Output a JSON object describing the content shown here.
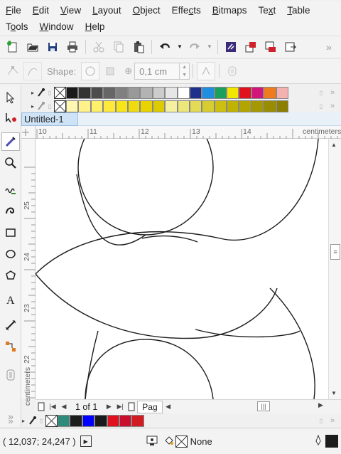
{
  "menus": {
    "row1": [
      {
        "label": "File",
        "u": "F",
        "rest": "ile"
      },
      {
        "label": "Edit",
        "u": "E",
        "rest": "dit"
      },
      {
        "label": "View",
        "u": "V",
        "rest": "iew"
      },
      {
        "label": "Layout",
        "u": "L",
        "rest": "ayout"
      },
      {
        "label": "Object",
        "u": "O",
        "rest": "bject"
      },
      {
        "label": "Effects",
        "pre": "Effe",
        "u": "c",
        "rest": "ts"
      },
      {
        "label": "Bitmaps",
        "u": "B",
        "rest": "itmaps"
      },
      {
        "label": "Text",
        "pre": "Te",
        "u": "x",
        "rest": "t"
      },
      {
        "label": "Table",
        "u": "T",
        "rest": "able"
      }
    ],
    "row2": [
      {
        "label": "Tools",
        "pre": "T",
        "u": "o",
        "rest": "ols"
      },
      {
        "label": "Window",
        "u": "W",
        "rest": "indow"
      },
      {
        "label": "Help",
        "u": "H",
        "rest": "elp"
      }
    ]
  },
  "property_bar": {
    "shape_label": "Shape:",
    "outline_width": "0,1 cm"
  },
  "palette_top": [
    "#1a1a1a",
    "#333333",
    "#4d4d4d",
    "#666666",
    "#808080",
    "#999999",
    "#b3b3b3",
    "#cccccc",
    "#e6e6e6",
    "#ffffff",
    "#1e2f8c",
    "#1e8fe0",
    "#1aa05a",
    "#f2e600",
    "#e0101e",
    "#d0167a",
    "#f07a1e",
    "#f5b0b0"
  ],
  "palette_second": [
    "#fff7b0",
    "#fff28a",
    "#fff06a",
    "#ffea3c",
    "#f7e51a",
    "#efdc10",
    "#e8d200",
    "#dccb00",
    "#f5f0a0",
    "#ede67a",
    "#e3da55",
    "#d8cd30",
    "#ccbf10",
    "#c0b200",
    "#b3a500",
    "#a69800",
    "#9a8c00",
    "#8c7f00"
  ],
  "palette_document": [
    "#2e8a7a",
    "#1c1c1c",
    "#0000ff",
    "#1a1a1a",
    "#e0101e",
    "#c8102e",
    "#d21c24"
  ],
  "document": {
    "tab_title": "Untitled-1"
  },
  "ruler": {
    "h_labels": [
      "10",
      "11",
      "12",
      "13",
      "14"
    ],
    "h_unit": "centimeters",
    "v_labels": [
      "25",
      "24",
      "23",
      "22"
    ],
    "v_unit": "centimeters"
  },
  "pager": {
    "page_info": "1 of 1",
    "page_tab": "Pag"
  },
  "status": {
    "coordinates": "( 12,037; 24,247 )",
    "fill_label": "None"
  },
  "colors": {
    "accent": "#cfe3f7",
    "active_tool_icon": "#4a4ab0",
    "outline_color": "#1c1c1c"
  }
}
